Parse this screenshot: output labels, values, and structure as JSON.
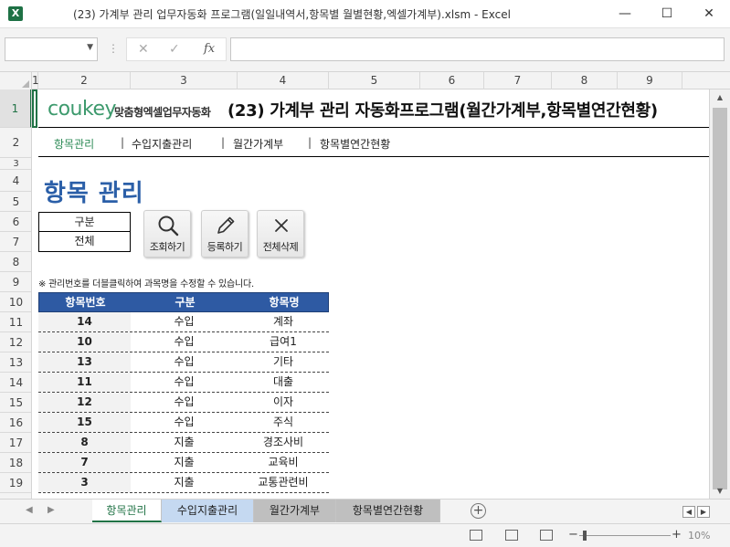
{
  "window": {
    "app_icon": "X",
    "title": "(23) 가계부 관리 업무자동화 프로그램(일일내역서,항목별 월별현황,엑셀가계부).xlsm  -  Excel",
    "minimize": "—",
    "maximize": "☐",
    "close": "✕"
  },
  "formula_bar": {
    "name_box": "",
    "cancel": "✕",
    "enter": "✓",
    "fx": "fx",
    "formula": ""
  },
  "columns": [
    "1",
    "2",
    "3",
    "4",
    "5",
    "6",
    "7",
    "8",
    "9"
  ],
  "rows": [
    "1",
    "2",
    "3",
    "4",
    "5",
    "6",
    "7",
    "8",
    "9",
    "10",
    "11",
    "12",
    "13",
    "14",
    "15",
    "16",
    "17",
    "18",
    "19"
  ],
  "banner": {
    "brand": "coukey",
    "brand_sub": "맞춤형엑셀업무자동화",
    "title": "(23) 가계부 관리 자동화프로그램(월간가계부,항목별연간현황)"
  },
  "nav": {
    "items": [
      "항목관리",
      "수입지출관리",
      "월간가계부",
      "항목별연간현황"
    ],
    "separator": "|"
  },
  "page_heading": "항목 관리",
  "filter": {
    "label": "구분",
    "value": "전체"
  },
  "buttons": {
    "search": "조회하기",
    "register": "등록하기",
    "delete_all": "전체삭제"
  },
  "note": "※ 관리번호를 더블클릭하여 과목명을 수정할 수 있습니다.",
  "table": {
    "headers": [
      "항목번호",
      "구분",
      "항목명"
    ],
    "rows": [
      [
        "14",
        "수입",
        "계좌"
      ],
      [
        "10",
        "수입",
        "급여1"
      ],
      [
        "13",
        "수입",
        "기타"
      ],
      [
        "11",
        "수입",
        "대출"
      ],
      [
        "12",
        "수입",
        "이자"
      ],
      [
        "15",
        "수입",
        "주식"
      ],
      [
        "8",
        "지출",
        "경조사비"
      ],
      [
        "7",
        "지출",
        "교육비"
      ],
      [
        "3",
        "지출",
        "교통관련비"
      ]
    ]
  },
  "sheet_tabs": [
    "항목관리",
    "수입지출관리",
    "월간가계부",
    "항목별연간현황"
  ],
  "status": {
    "zoom": "10%",
    "zoom_minus": "−",
    "zoom_plus": "+"
  },
  "colors": {
    "excel_green": "#217346",
    "heading_blue": "#2b5fa8",
    "table_header": "#2e5aa3",
    "tab_blue": "#c5d9f1",
    "tab_gray": "#bfbfbf"
  }
}
